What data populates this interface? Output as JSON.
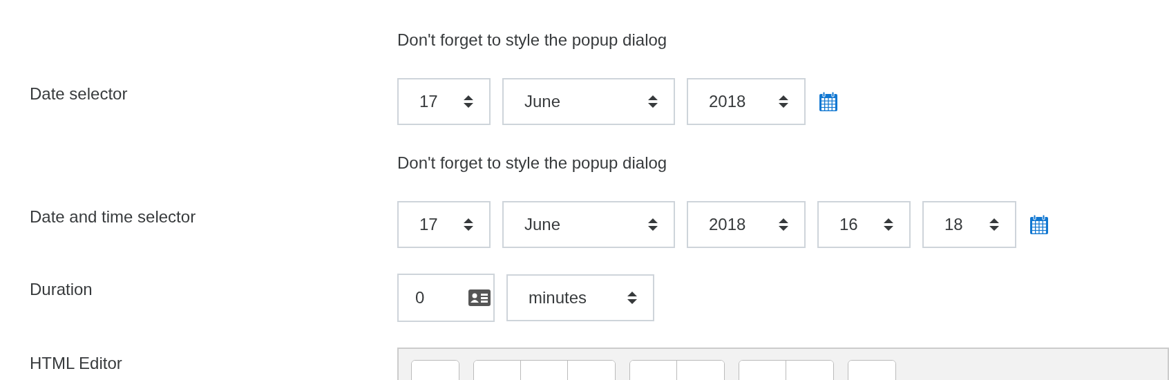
{
  "rows": [
    {
      "kind": "hint",
      "text": "Don't forget to style the popup dialog"
    },
    {
      "kind": "selects",
      "label": "Date selector",
      "calendar": true,
      "selects": [
        {
          "kind": "day",
          "value": "17"
        },
        {
          "kind": "month",
          "value": "June"
        },
        {
          "kind": "year",
          "value": "2018"
        }
      ]
    },
    {
      "kind": "hint",
      "text": "Don't forget to style the popup dialog"
    },
    {
      "kind": "selects",
      "label": "Date and time selector",
      "calendar": true,
      "selects": [
        {
          "kind": "day",
          "value": "17"
        },
        {
          "kind": "month",
          "value": "June"
        },
        {
          "kind": "year",
          "value": "2018"
        },
        {
          "kind": "hour",
          "value": "16"
        },
        {
          "kind": "minute",
          "value": "18"
        }
      ]
    },
    {
      "kind": "duration",
      "label": "Duration",
      "value": "0",
      "unit": "minutes"
    },
    {
      "kind": "editor",
      "label": "HTML Editor"
    }
  ]
}
